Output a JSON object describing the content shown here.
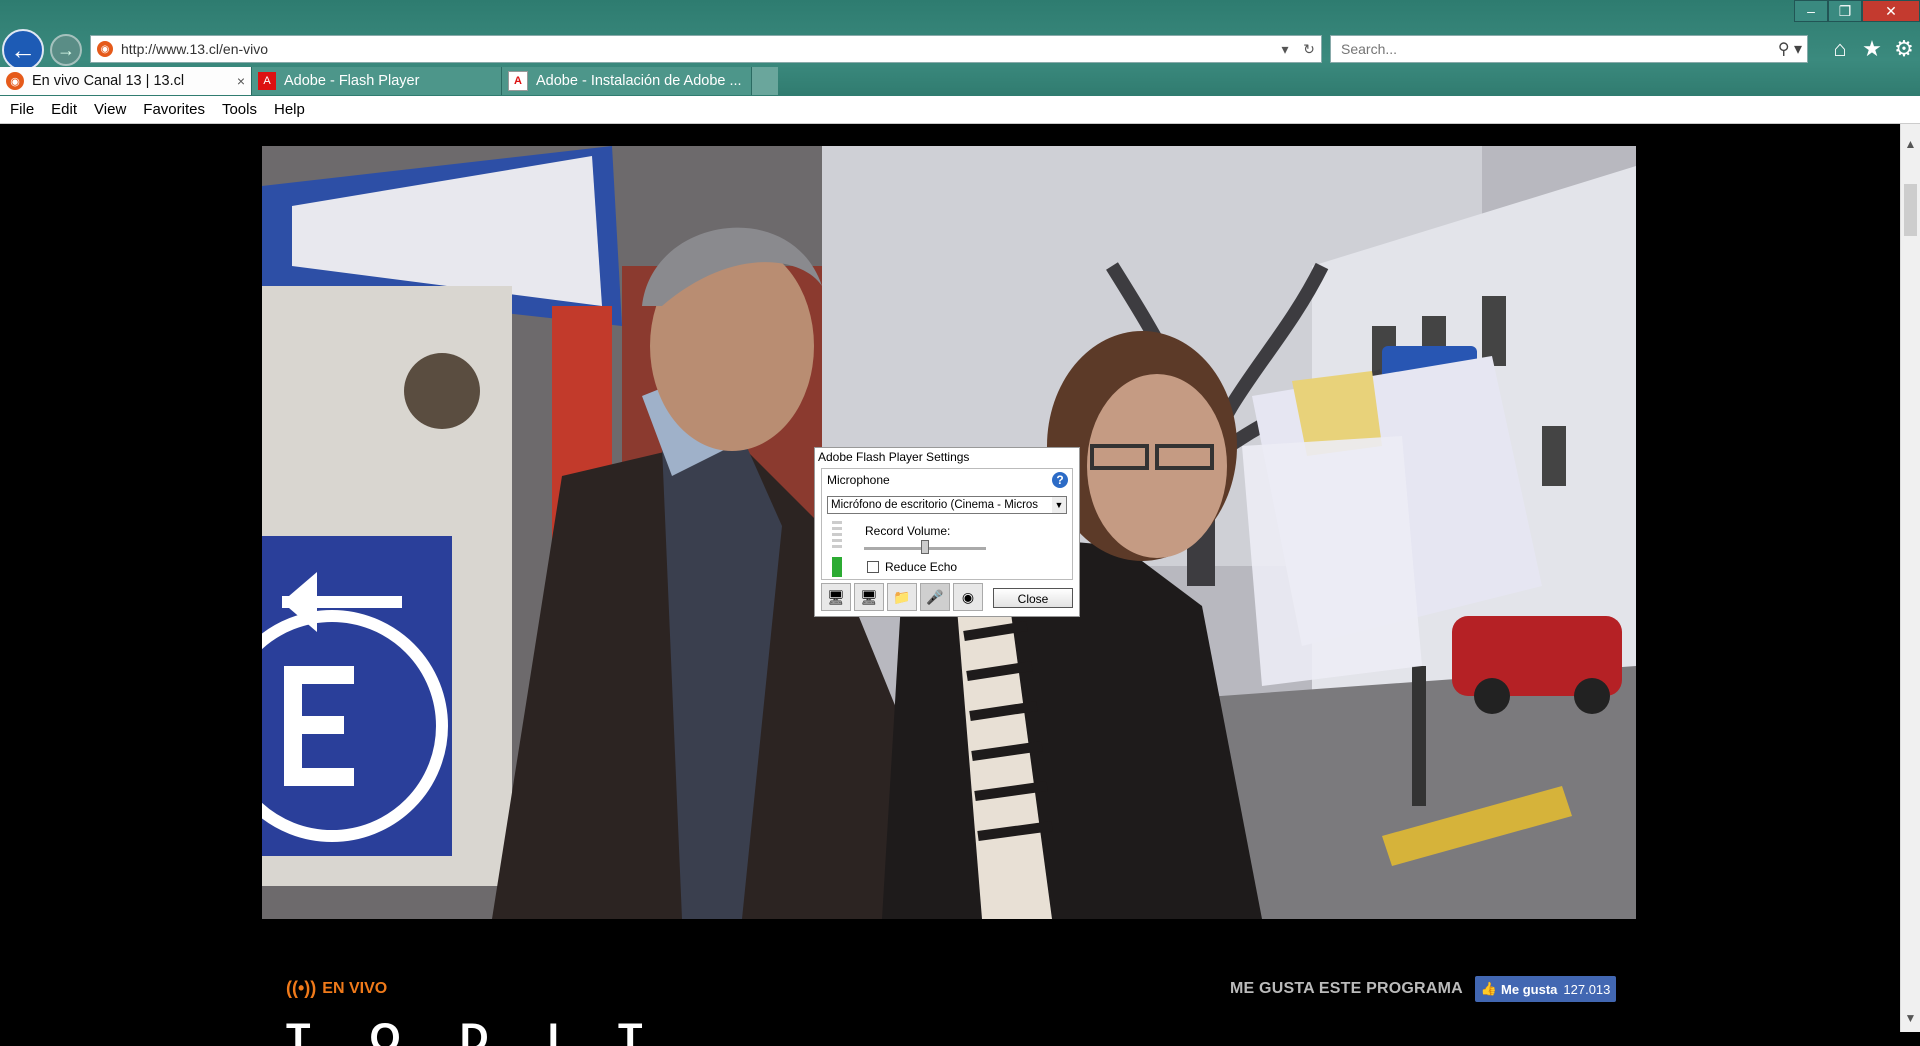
{
  "browser": {
    "url": "http://www.13.cl/en-vivo",
    "search_placeholder": "Search...",
    "tabs": [
      {
        "label": "En vivo Canal 13 | 13.cl",
        "active": true
      },
      {
        "label": "Adobe - Flash Player",
        "active": false
      },
      {
        "label": "Adobe - Instalación de Adobe ...",
        "active": false
      }
    ],
    "menu": [
      {
        "letter": "F",
        "rest": "ile"
      },
      {
        "letter": "E",
        "rest": "dit"
      },
      {
        "letter": "V",
        "rest": "iew"
      },
      {
        "letter": "",
        "rest": "Favorites",
        "letter_index": 1
      },
      {
        "letter": "T",
        "rest": "ools"
      },
      {
        "letter": "H",
        "rest": "elp"
      }
    ],
    "menu_labels": [
      "File",
      "Edit",
      "View",
      "Favorites",
      "Tools",
      "Help"
    ],
    "tab_close_symbol": "×"
  },
  "flash_dialog": {
    "title": "Adobe Flash Player Settings",
    "section": "Microphone",
    "help_symbol": "?",
    "device_selected": "Micrófono de escritorio (Cinema - Micros",
    "record_volume_label": "Record Volume:",
    "record_volume_level": 0.5,
    "reduce_echo_label": "Reduce Echo",
    "reduce_echo_checked": false,
    "input_meter_level": 0.35,
    "close_label": "Close"
  },
  "page": {
    "live_label": "EN VIVO",
    "like_prompt": "ME GUSTA ESTE PROGRAMA",
    "like_button_label": "Me gusta",
    "like_count": "127.013",
    "bottom_partial_text": "T O D I T"
  },
  "colors": {
    "accent_live": "#f07a1a",
    "facebook_blue": "#4267b2",
    "browser_frame": "#2f7a6e"
  }
}
